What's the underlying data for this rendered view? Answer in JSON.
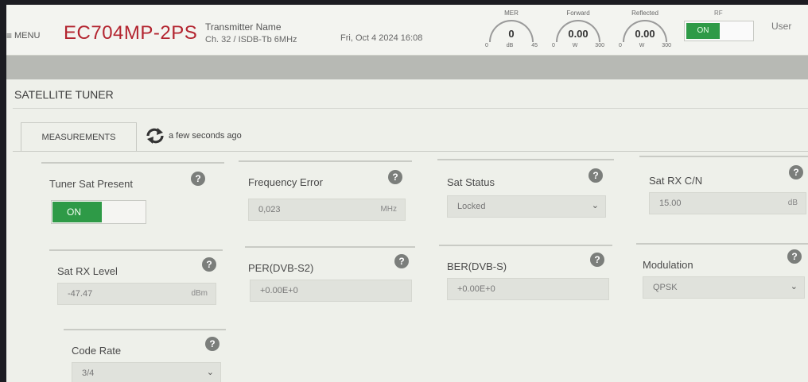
{
  "header": {
    "menu_label": "MENU",
    "model": "EC704MP-2PS",
    "transmitter_name": "Transmitter Name",
    "channel": "Ch. 32 / ISDB-Tb 6MHz",
    "datetime": "Fri, Oct 4 2024 16:08",
    "gauges": [
      {
        "label": "MER",
        "value": "0",
        "min": "0",
        "unit": "dB",
        "max": "45"
      },
      {
        "label": "Forward",
        "value": "0.00",
        "min": "0",
        "unit": "W",
        "max": "300"
      },
      {
        "label": "Reflected",
        "value": "0.00",
        "min": "0",
        "unit": "W",
        "max": "300"
      }
    ],
    "rf_label": "RF",
    "rf_state": "ON",
    "user": "User"
  },
  "page_title": "SATELLITE TUNER",
  "tab_label": "MEASUREMENTS",
  "refresh_text": "a few seconds ago",
  "cards": {
    "tuner_sat_present": {
      "label": "Tuner Sat Present",
      "state": "ON"
    },
    "frequency_error": {
      "label": "Frequency Error",
      "value": "0,023",
      "unit": "MHz"
    },
    "sat_status": {
      "label": "Sat Status",
      "value": "Locked"
    },
    "sat_rx_cn": {
      "label": "Sat RX C/N",
      "value": "15.00",
      "unit": "dB"
    },
    "sat_rx_level": {
      "label": "Sat RX Level",
      "value": "-47.47",
      "unit": "dBm"
    },
    "per": {
      "label": "PER(DVB-S2)",
      "value": "+0.00E+0"
    },
    "ber": {
      "label": "BER(DVB-S)",
      "value": "+0.00E+0"
    },
    "modulation": {
      "label": "Modulation",
      "value": "QPSK"
    },
    "code_rate": {
      "label": "Code Rate",
      "value": "3/4"
    }
  },
  "help_glyph": "?",
  "colors": {
    "brand_red": "#b3242f",
    "on_green": "#2e9a47"
  }
}
